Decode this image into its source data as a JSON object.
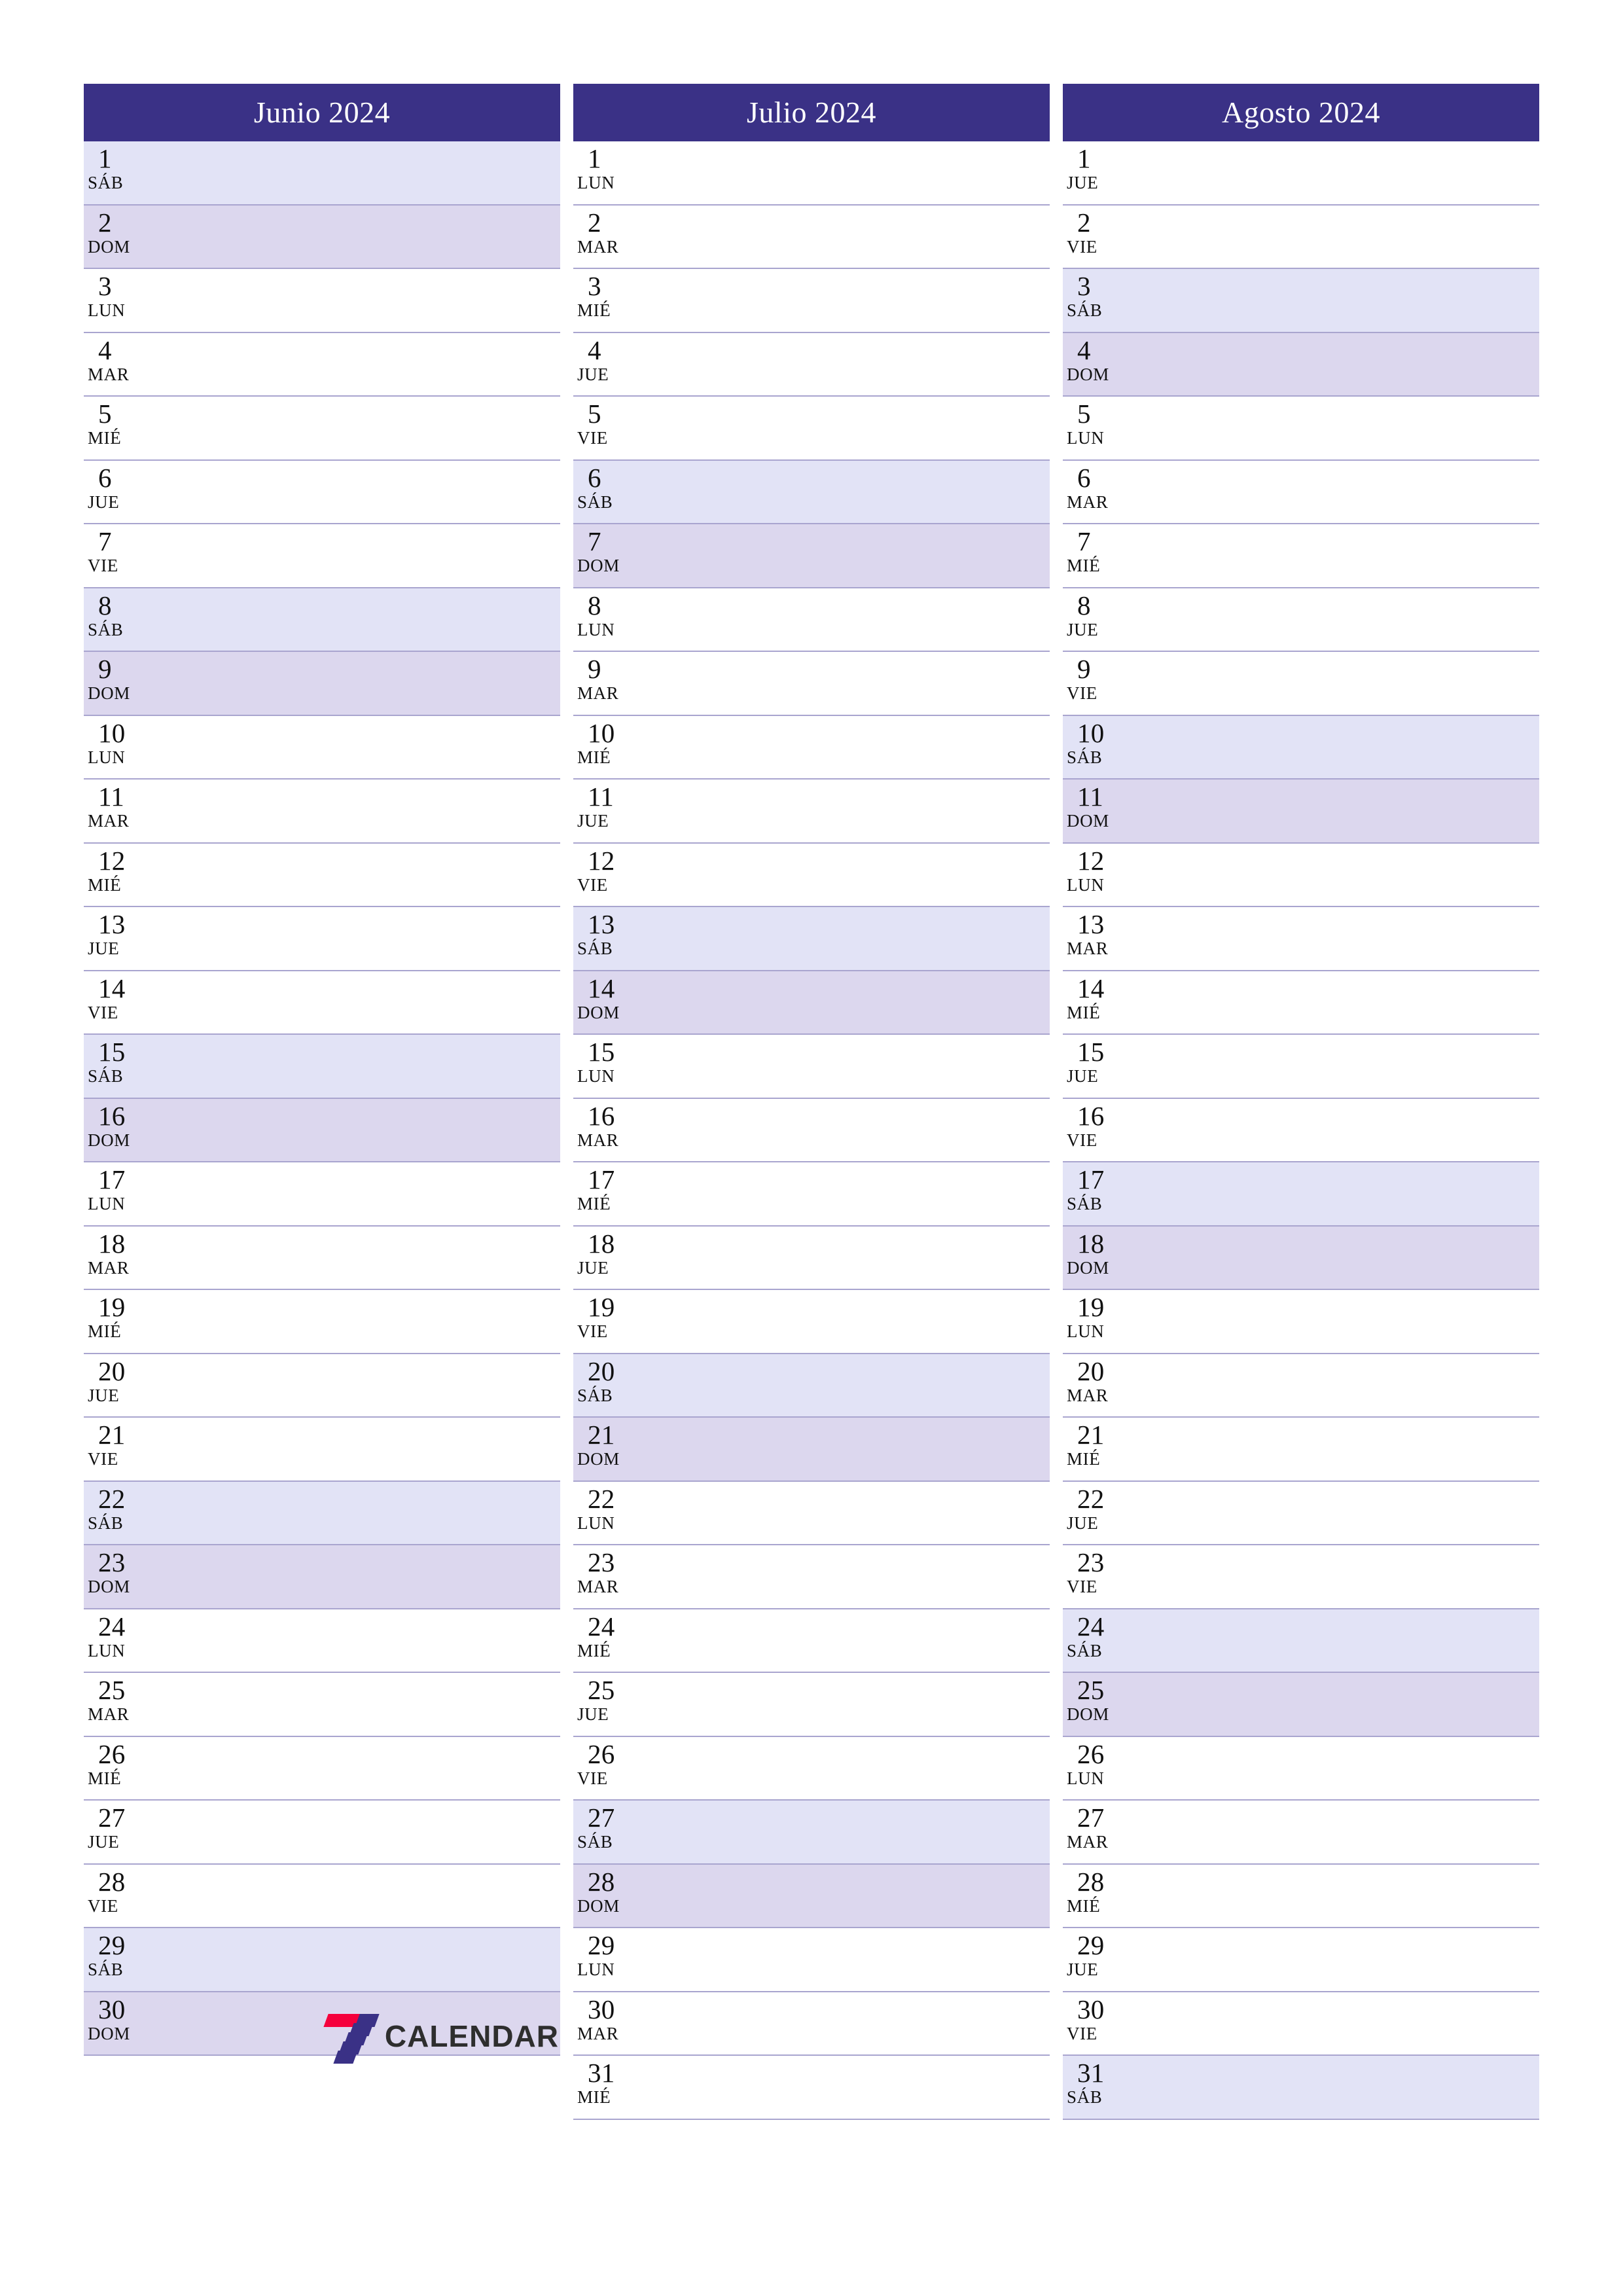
{
  "page": {
    "background_color": "#ffffff",
    "header_color": "#3a3186",
    "saturday_color": "#e2e3f6",
    "sunday_color": "#dcd7ee",
    "grid_line_color": "#a9a5cf",
    "text_color": "#111111"
  },
  "logo": {
    "text": "CALENDAR",
    "mark_red": "#f5003c",
    "mark_purple": "#3a3186"
  },
  "months": [
    {
      "title": "Junio 2024",
      "days": [
        {
          "num": "1",
          "name": "SÁB",
          "type": "sat"
        },
        {
          "num": "2",
          "name": "DOM",
          "type": "sun"
        },
        {
          "num": "3",
          "name": "LUN",
          "type": "weekday"
        },
        {
          "num": "4",
          "name": "MAR",
          "type": "weekday"
        },
        {
          "num": "5",
          "name": "MIÉ",
          "type": "weekday"
        },
        {
          "num": "6",
          "name": "JUE",
          "type": "weekday"
        },
        {
          "num": "7",
          "name": "VIE",
          "type": "weekday"
        },
        {
          "num": "8",
          "name": "SÁB",
          "type": "sat"
        },
        {
          "num": "9",
          "name": "DOM",
          "type": "sun"
        },
        {
          "num": "10",
          "name": "LUN",
          "type": "weekday"
        },
        {
          "num": "11",
          "name": "MAR",
          "type": "weekday"
        },
        {
          "num": "12",
          "name": "MIÉ",
          "type": "weekday"
        },
        {
          "num": "13",
          "name": "JUE",
          "type": "weekday"
        },
        {
          "num": "14",
          "name": "VIE",
          "type": "weekday"
        },
        {
          "num": "15",
          "name": "SÁB",
          "type": "sat"
        },
        {
          "num": "16",
          "name": "DOM",
          "type": "sun"
        },
        {
          "num": "17",
          "name": "LUN",
          "type": "weekday"
        },
        {
          "num": "18",
          "name": "MAR",
          "type": "weekday"
        },
        {
          "num": "19",
          "name": "MIÉ",
          "type": "weekday"
        },
        {
          "num": "20",
          "name": "JUE",
          "type": "weekday"
        },
        {
          "num": "21",
          "name": "VIE",
          "type": "weekday"
        },
        {
          "num": "22",
          "name": "SÁB",
          "type": "sat"
        },
        {
          "num": "23",
          "name": "DOM",
          "type": "sun"
        },
        {
          "num": "24",
          "name": "LUN",
          "type": "weekday"
        },
        {
          "num": "25",
          "name": "MAR",
          "type": "weekday"
        },
        {
          "num": "26",
          "name": "MIÉ",
          "type": "weekday"
        },
        {
          "num": "27",
          "name": "JUE",
          "type": "weekday"
        },
        {
          "num": "28",
          "name": "VIE",
          "type": "weekday"
        },
        {
          "num": "29",
          "name": "SÁB",
          "type": "sat"
        },
        {
          "num": "30",
          "name": "DOM",
          "type": "sun"
        }
      ]
    },
    {
      "title": "Julio 2024",
      "days": [
        {
          "num": "1",
          "name": "LUN",
          "type": "weekday"
        },
        {
          "num": "2",
          "name": "MAR",
          "type": "weekday"
        },
        {
          "num": "3",
          "name": "MIÉ",
          "type": "weekday"
        },
        {
          "num": "4",
          "name": "JUE",
          "type": "weekday"
        },
        {
          "num": "5",
          "name": "VIE",
          "type": "weekday"
        },
        {
          "num": "6",
          "name": "SÁB",
          "type": "sat"
        },
        {
          "num": "7",
          "name": "DOM",
          "type": "sun"
        },
        {
          "num": "8",
          "name": "LUN",
          "type": "weekday"
        },
        {
          "num": "9",
          "name": "MAR",
          "type": "weekday"
        },
        {
          "num": "10",
          "name": "MIÉ",
          "type": "weekday"
        },
        {
          "num": "11",
          "name": "JUE",
          "type": "weekday"
        },
        {
          "num": "12",
          "name": "VIE",
          "type": "weekday"
        },
        {
          "num": "13",
          "name": "SÁB",
          "type": "sat"
        },
        {
          "num": "14",
          "name": "DOM",
          "type": "sun"
        },
        {
          "num": "15",
          "name": "LUN",
          "type": "weekday"
        },
        {
          "num": "16",
          "name": "MAR",
          "type": "weekday"
        },
        {
          "num": "17",
          "name": "MIÉ",
          "type": "weekday"
        },
        {
          "num": "18",
          "name": "JUE",
          "type": "weekday"
        },
        {
          "num": "19",
          "name": "VIE",
          "type": "weekday"
        },
        {
          "num": "20",
          "name": "SÁB",
          "type": "sat"
        },
        {
          "num": "21",
          "name": "DOM",
          "type": "sun"
        },
        {
          "num": "22",
          "name": "LUN",
          "type": "weekday"
        },
        {
          "num": "23",
          "name": "MAR",
          "type": "weekday"
        },
        {
          "num": "24",
          "name": "MIÉ",
          "type": "weekday"
        },
        {
          "num": "25",
          "name": "JUE",
          "type": "weekday"
        },
        {
          "num": "26",
          "name": "VIE",
          "type": "weekday"
        },
        {
          "num": "27",
          "name": "SÁB",
          "type": "sat"
        },
        {
          "num": "28",
          "name": "DOM",
          "type": "sun"
        },
        {
          "num": "29",
          "name": "LUN",
          "type": "weekday"
        },
        {
          "num": "30",
          "name": "MAR",
          "type": "weekday"
        },
        {
          "num": "31",
          "name": "MIÉ",
          "type": "weekday"
        }
      ]
    },
    {
      "title": "Agosto 2024",
      "days": [
        {
          "num": "1",
          "name": "JUE",
          "type": "weekday"
        },
        {
          "num": "2",
          "name": "VIE",
          "type": "weekday"
        },
        {
          "num": "3",
          "name": "SÁB",
          "type": "sat"
        },
        {
          "num": "4",
          "name": "DOM",
          "type": "sun"
        },
        {
          "num": "5",
          "name": "LUN",
          "type": "weekday"
        },
        {
          "num": "6",
          "name": "MAR",
          "type": "weekday"
        },
        {
          "num": "7",
          "name": "MIÉ",
          "type": "weekday"
        },
        {
          "num": "8",
          "name": "JUE",
          "type": "weekday"
        },
        {
          "num": "9",
          "name": "VIE",
          "type": "weekday"
        },
        {
          "num": "10",
          "name": "SÁB",
          "type": "sat"
        },
        {
          "num": "11",
          "name": "DOM",
          "type": "sun"
        },
        {
          "num": "12",
          "name": "LUN",
          "type": "weekday"
        },
        {
          "num": "13",
          "name": "MAR",
          "type": "weekday"
        },
        {
          "num": "14",
          "name": "MIÉ",
          "type": "weekday"
        },
        {
          "num": "15",
          "name": "JUE",
          "type": "weekday"
        },
        {
          "num": "16",
          "name": "VIE",
          "type": "weekday"
        },
        {
          "num": "17",
          "name": "SÁB",
          "type": "sat"
        },
        {
          "num": "18",
          "name": "DOM",
          "type": "sun"
        },
        {
          "num": "19",
          "name": "LUN",
          "type": "weekday"
        },
        {
          "num": "20",
          "name": "MAR",
          "type": "weekday"
        },
        {
          "num": "21",
          "name": "MIÉ",
          "type": "weekday"
        },
        {
          "num": "22",
          "name": "JUE",
          "type": "weekday"
        },
        {
          "num": "23",
          "name": "VIE",
          "type": "weekday"
        },
        {
          "num": "24",
          "name": "SÁB",
          "type": "sat"
        },
        {
          "num": "25",
          "name": "DOM",
          "type": "sun"
        },
        {
          "num": "26",
          "name": "LUN",
          "type": "weekday"
        },
        {
          "num": "27",
          "name": "MAR",
          "type": "weekday"
        },
        {
          "num": "28",
          "name": "MIÉ",
          "type": "weekday"
        },
        {
          "num": "29",
          "name": "JUE",
          "type": "weekday"
        },
        {
          "num": "30",
          "name": "VIE",
          "type": "weekday"
        },
        {
          "num": "31",
          "name": "SÁB",
          "type": "sat"
        }
      ]
    }
  ]
}
